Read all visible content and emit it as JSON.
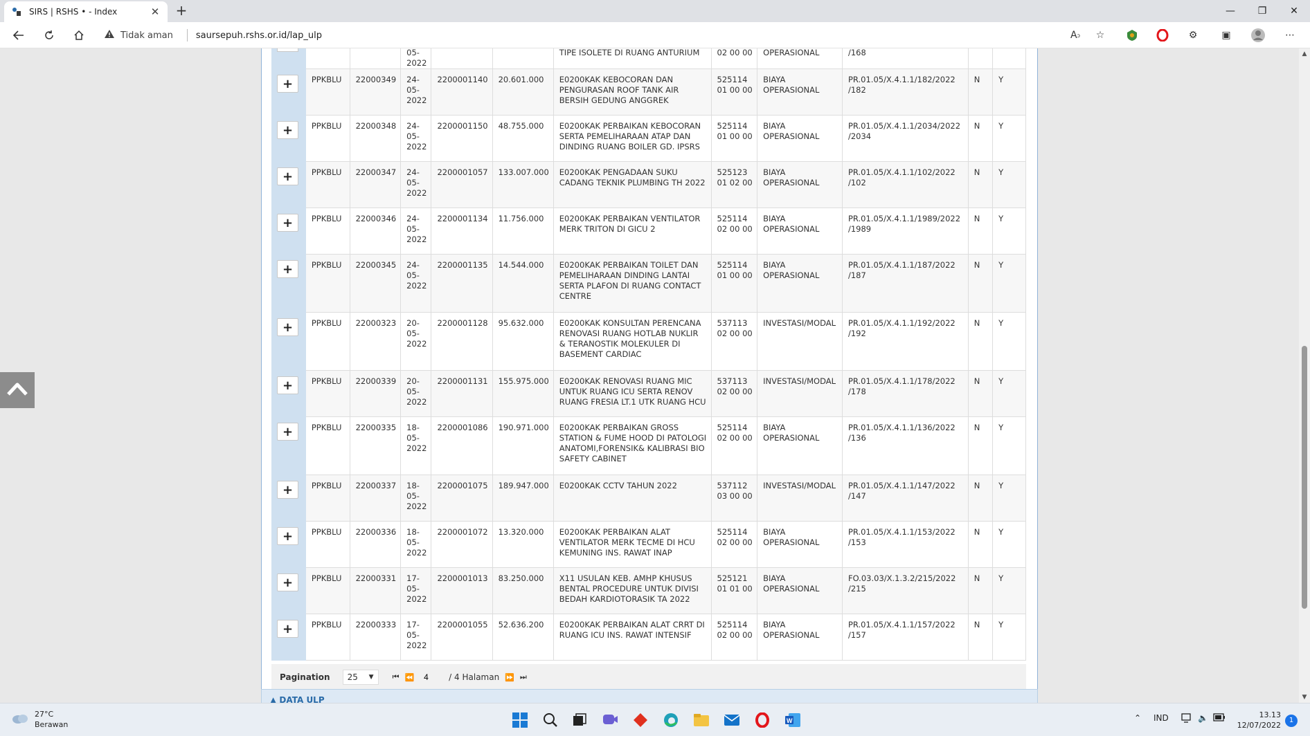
{
  "browser": {
    "tab_title": "SIRS | RSHS • - Index",
    "security_label": "Tidak aman",
    "url": "saursepuh.rshs.or.id/lap_ulp"
  },
  "table": {
    "top_partial": {
      "date": "05-\n2022",
      "uraian": "TIPE ISOLETE DI RUANG ANTURIUM",
      "akun": "02 00 00",
      "jenis": "OPERASIONAL",
      "nomor": "/168"
    },
    "rows": [
      {
        "sumber": "PPKBLU",
        "no": "22000349",
        "tanggal": "24-\n05-\n2022",
        "kode": "2200001140",
        "nilai": "20.601.000",
        "uraian": "E0200KAK KEBOCORAN DAN PENGURASAN ROOF TANK AIR BERSIH GEDUNG ANGGREK",
        "akun": "525114\n01 00 00",
        "jenis": "BIAYA\nOPERASIONAL",
        "nomor": "PR.01.05/X.4.1.1/182/2022\n/182",
        "f1": "N",
        "f2": "Y"
      },
      {
        "sumber": "PPKBLU",
        "no": "22000348",
        "tanggal": "24-\n05-\n2022",
        "kode": "2200001150",
        "nilai": "48.755.000",
        "uraian": "E0200KAK PERBAIKAN KEBOCORAN SERTA PEMELIHARAAN ATAP DAN DINDING RUANG BOILER GD. IPSRS",
        "akun": "525114\n01 00 00",
        "jenis": "BIAYA\nOPERASIONAL",
        "nomor": "PR.01.05/X.4.1.1/2034/2022\n/2034",
        "f1": "N",
        "f2": "Y"
      },
      {
        "sumber": "PPKBLU",
        "no": "22000347",
        "tanggal": "24-\n05-\n2022",
        "kode": "2200001057",
        "nilai": "133.007.000",
        "uraian": "E0200KAK PENGADAAN SUKU CADANG TEKNIK PLUMBING TH 2022",
        "akun": "525123\n01 02 00",
        "jenis": "BIAYA\nOPERASIONAL",
        "nomor": "PR.01.05/X.4.1.1/102/2022\n/102",
        "f1": "N",
        "f2": "Y"
      },
      {
        "sumber": "PPKBLU",
        "no": "22000346",
        "tanggal": "24-\n05-\n2022",
        "kode": "2200001134",
        "nilai": "11.756.000",
        "uraian": "E0200KAK PERBAIKAN VENTILATOR MERK TRITON DI GICU 2",
        "akun": "525114\n02 00 00",
        "jenis": "BIAYA\nOPERASIONAL",
        "nomor": "PR.01.05/X.4.1.1/1989/2022\n/1989",
        "f1": "N",
        "f2": "Y"
      },
      {
        "sumber": "PPKBLU",
        "no": "22000345",
        "tanggal": "24-\n05-\n2022",
        "kode": "2200001135",
        "nilai": "14.544.000",
        "uraian": "E0200KAK PERBAIKAN TOILET DAN PEMELIHARAAN DINDING LANTAI SERTA PLAFON DI RUANG CONTACT CENTRE",
        "akun": "525114\n01 00 00",
        "jenis": "BIAYA\nOPERASIONAL",
        "nomor": "PR.01.05/X.4.1.1/187/2022\n/187",
        "f1": "N",
        "f2": "Y"
      },
      {
        "sumber": "PPKBLU",
        "no": "22000323",
        "tanggal": "20-\n05-\n2022",
        "kode": "2200001128",
        "nilai": "95.632.000",
        "uraian": "E0200KAK KONSULTAN PERENCANA RENOVASI RUANG HOTLAB NUKLIR & TERANOSTIK MOLEKULER DI BASEMENT CARDIAC",
        "akun": "537113\n02 00 00",
        "jenis": "INVESTASI/MODAL",
        "nomor": "PR.01.05/X.4.1.1/192/2022\n/192",
        "f1": "N",
        "f2": "Y"
      },
      {
        "sumber": "PPKBLU",
        "no": "22000339",
        "tanggal": "20-\n05-\n2022",
        "kode": "2200001131",
        "nilai": "155.975.000",
        "uraian": "E0200KAK RENOVASI RUANG MIC UNTUK RUANG ICU SERTA RENOV RUANG FRESIA LT.1 UTK RUANG HCU",
        "akun": "537113\n02 00 00",
        "jenis": "INVESTASI/MODAL",
        "nomor": "PR.01.05/X.4.1.1/178/2022\n/178",
        "f1": "N",
        "f2": "Y"
      },
      {
        "sumber": "PPKBLU",
        "no": "22000335",
        "tanggal": "18-\n05-\n2022",
        "kode": "2200001086",
        "nilai": "190.971.000",
        "uraian": "E0200KAK PERBAIKAN GROSS STATION & FUME HOOD DI PATOLOGI ANATOMI,FORENSIK& KALIBRASI BIO SAFETY CABINET",
        "akun": "525114\n02 00 00",
        "jenis": "BIAYA\nOPERASIONAL",
        "nomor": "PR.01.05/X.4.1.1/136/2022\n/136",
        "f1": "N",
        "f2": "Y"
      },
      {
        "sumber": "PPKBLU",
        "no": "22000337",
        "tanggal": "18-\n05-\n2022",
        "kode": "2200001075",
        "nilai": "189.947.000",
        "uraian": "E0200KAK CCTV TAHUN 2022",
        "akun": "537112\n03 00 00",
        "jenis": "INVESTASI/MODAL",
        "nomor": "PR.01.05/X.4.1.1/147/2022\n/147",
        "f1": "N",
        "f2": "Y"
      },
      {
        "sumber": "PPKBLU",
        "no": "22000336",
        "tanggal": "18-\n05-\n2022",
        "kode": "2200001072",
        "nilai": "13.320.000",
        "uraian": "E0200KAK PERBAIKAN ALAT VENTILATOR MERK TECME DI HCU KEMUNING INS. RAWAT INAP",
        "akun": "525114\n02 00 00",
        "jenis": "BIAYA\nOPERASIONAL",
        "nomor": "PR.01.05/X.4.1.1/153/2022\n/153",
        "f1": "N",
        "f2": "Y"
      },
      {
        "sumber": "PPKBLU",
        "no": "22000331",
        "tanggal": "17-\n05-\n2022",
        "kode": "2200001013",
        "nilai": "83.250.000",
        "uraian": "X11 USULAN KEB. AMHP KHUSUS BENTAL PROCEDURE UNTUK DIVISI BEDAH KARDIOTORASIK TA 2022",
        "akun": "525121\n01 01 00",
        "jenis": "BIAYA\nOPERASIONAL",
        "nomor": "FO.03.03/X.1.3.2/215/2022\n/215",
        "f1": "N",
        "f2": "Y"
      },
      {
        "sumber": "PPKBLU",
        "no": "22000333",
        "tanggal": "17-\n05-\n2022",
        "kode": "2200001055",
        "nilai": "52.636.200",
        "uraian": "E0200KAK PERBAIKAN ALAT CRRT DI RUANG ICU INS. RAWAT INTENSIF",
        "akun": "525114\n02 00 00",
        "jenis": "BIAYA\nOPERASIONAL",
        "nomor": "PR.01.05/X.4.1.1/157/2022\n/157",
        "f1": "N",
        "f2": "Y"
      }
    ]
  },
  "pagination": {
    "label": "Pagination",
    "page_size": "25",
    "current_page": "4",
    "total_text": "/ 4 Halaman"
  },
  "next_section": {
    "title": "▲ DATA ULP"
  },
  "taskbar": {
    "temperature": "27°C",
    "weather": "Berawan",
    "language": "IND",
    "time": "13.13",
    "date": "12/07/2022",
    "notification_count": "1"
  }
}
